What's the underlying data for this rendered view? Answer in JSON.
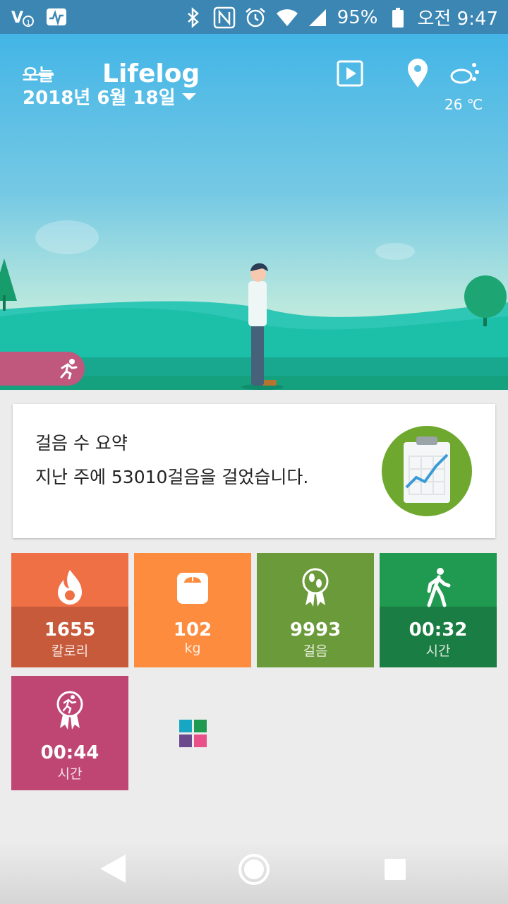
{
  "status_bar": {
    "battery": "95%",
    "time": "오전 9:47",
    "icons": [
      "volte-icon",
      "activity-icon",
      "bluetooth-icon",
      "nfc-icon",
      "alarm-icon",
      "wifi-icon",
      "signal-icon",
      "battery-icon"
    ]
  },
  "header": {
    "today_label": "오늘",
    "app_title": "Lifelog",
    "date": "2018년 6월 18일",
    "temperature": "26 ℃",
    "icons": [
      "play-icon",
      "location-pin-icon",
      "weather-icon"
    ]
  },
  "summary": {
    "title": "걸음 수 요약",
    "description": "지난 주에 53010걸음을 걸었습니다."
  },
  "tiles": [
    {
      "value": "1655",
      "label": "칼로리",
      "icon": "flame-icon",
      "color": "#c65a3a",
      "top_color": "#f07046"
    },
    {
      "value": "102",
      "label": "kg",
      "icon": "scale-icon",
      "color": "#fd8c3f"
    },
    {
      "value": "9993",
      "label": "걸음",
      "icon": "steps-medal-icon",
      "color": "#6b9a3a"
    },
    {
      "value": "00:32",
      "label": "시간",
      "icon": "walking-icon",
      "color": "#1a7d43",
      "top_color": "#1f9a50"
    },
    {
      "value": "00:44",
      "label": "시간",
      "icon": "running-medal-icon",
      "color": "#bf4572"
    }
  ],
  "colors": {
    "status_bar": "#3b86b3",
    "hill_front": "#1cbfa8",
    "hill_back": "#2ec7b6",
    "stripe": "#17a88f",
    "card_badge": "#6ea82e"
  }
}
